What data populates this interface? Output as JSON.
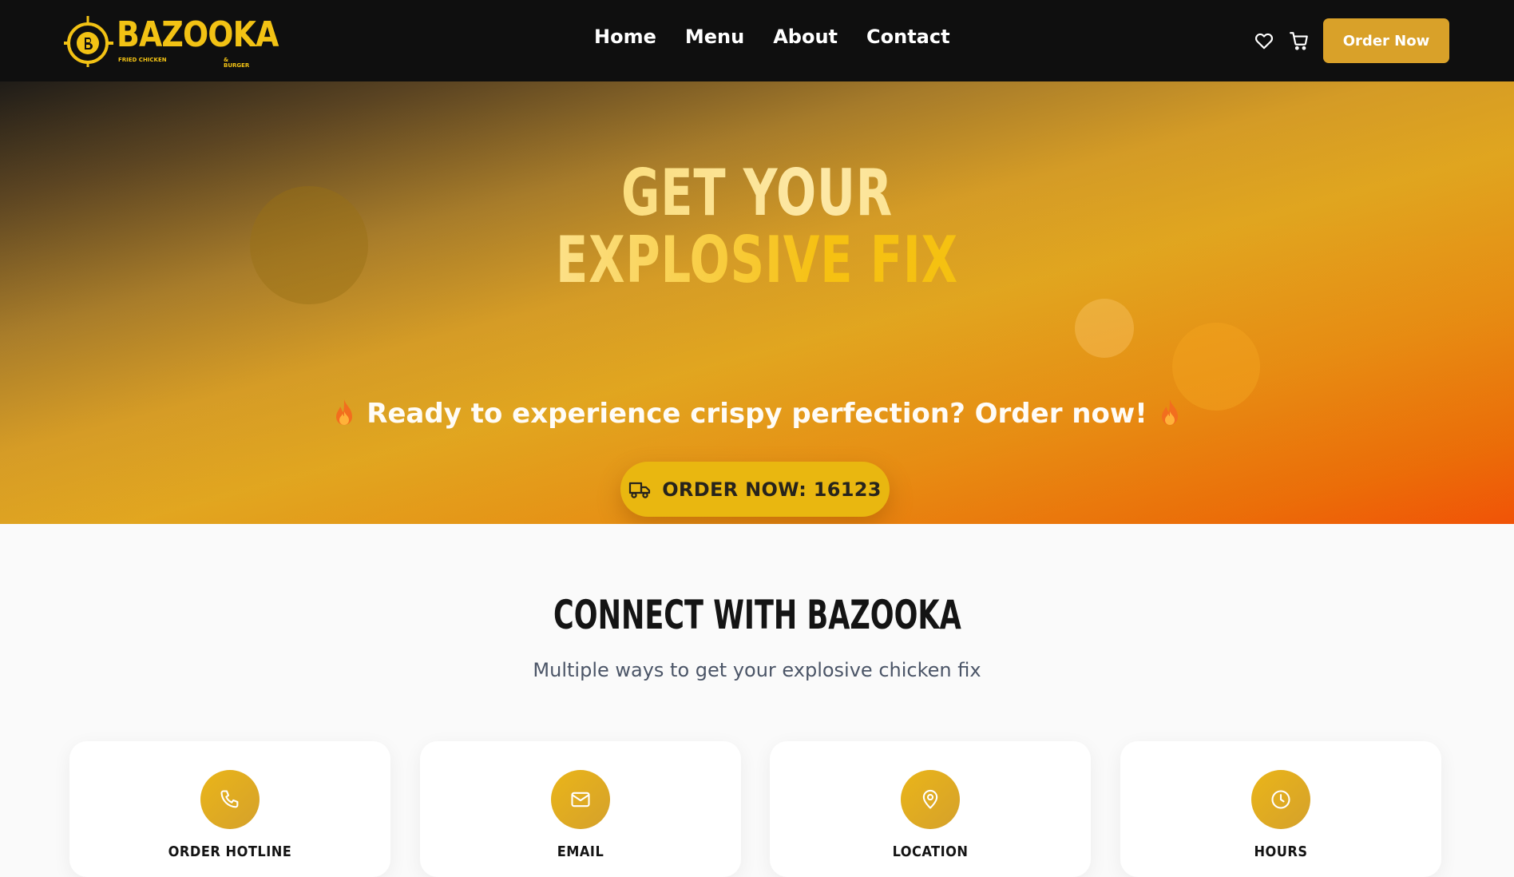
{
  "brand": {
    "name": "BAZOOKA",
    "tagline_left": "FRIED CHICKEN",
    "tagline_right": "& BURGER",
    "color_primary": "#f2c214",
    "color_accent": "#d9a129"
  },
  "nav": {
    "links": [
      "Home",
      "Menu",
      "About",
      "Contact"
    ],
    "favorites_icon": "heart-icon",
    "cart_icon": "cart-icon",
    "order_button": "Order Now"
  },
  "hero": {
    "title_line1": "GET YOUR",
    "title_line2": "EXPLOSIVE FIX",
    "tagline": "Ready to experience crispy perfection? Order now!",
    "tagline_icon": "fire-icon",
    "cta_icon": "truck-icon",
    "cta_label": "ORDER NOW: 16123"
  },
  "connect": {
    "title": "CONNECT WITH BAZOOKA",
    "subtitle": "Multiple ways to get your explosive chicken fix",
    "cards": [
      {
        "icon": "phone-icon",
        "label": "ORDER HOTLINE"
      },
      {
        "icon": "mail-icon",
        "label": "EMAIL"
      },
      {
        "icon": "location-pin-icon",
        "label": "LOCATION"
      },
      {
        "icon": "clock-icon",
        "label": "HOURS"
      }
    ]
  }
}
